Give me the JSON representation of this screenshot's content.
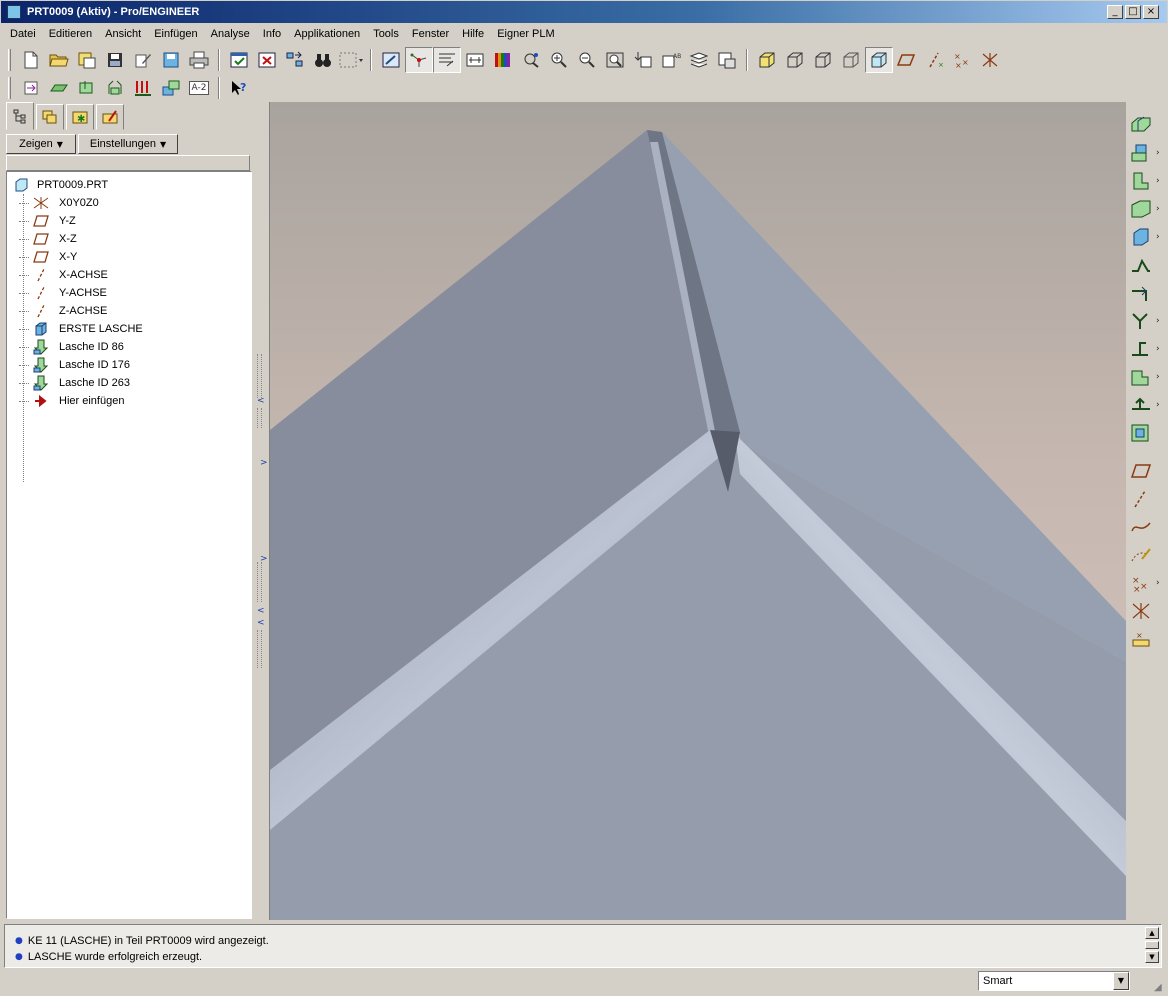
{
  "window": {
    "title": "PRT0009 (Aktiv) - Pro/ENGINEER",
    "buttons": [
      "_",
      "□",
      "×"
    ]
  },
  "menu": [
    {
      "label": "Datei"
    },
    {
      "label": "Editieren"
    },
    {
      "label": "Ansicht"
    },
    {
      "label": "Einfügen"
    },
    {
      "label": "Analyse"
    },
    {
      "label": "Info"
    },
    {
      "label": "Applikationen"
    },
    {
      "label": "Tools"
    },
    {
      "label": "Fenster"
    },
    {
      "label": "Hilfe"
    },
    {
      "label": "Eigner PLM"
    }
  ],
  "toolbar": {
    "row1": [
      "new-file",
      "open-folder",
      "save-as",
      "save",
      "edit",
      "disk",
      "print",
      "regenerate",
      "close-window",
      "swap",
      "binoculars",
      "select-box",
      "repaint",
      "spin-center",
      "saved-views",
      "orient",
      "color-appearance",
      "layers",
      "zoom-in",
      "zoom-out",
      "refit",
      "reorient",
      "view-manager",
      "layer-tree",
      "model-display",
      "wireframe",
      "hidden-line",
      "no-hidden",
      "shaded",
      "datum-planes",
      "datum-axes",
      "datum-points",
      "csys"
    ],
    "row2": [
      "import",
      "sheet",
      "merge",
      "scale",
      "analysis",
      "move",
      "text-a2",
      "context-help"
    ],
    "text_icon_label": "A-2"
  },
  "left_panel": {
    "tabs": [
      "model-tree-tab",
      "layers-tab",
      "favorites-tab",
      "folder-tab"
    ],
    "show_button": "Zeigen",
    "settings_button": "Einstellungen",
    "root": "PRT0009.PRT",
    "items": [
      {
        "label": "X0Y0Z0",
        "icon": "csys-icon"
      },
      {
        "label": "Y-Z",
        "icon": "datum-plane-icon"
      },
      {
        "label": "X-Z",
        "icon": "datum-plane-icon"
      },
      {
        "label": "X-Y",
        "icon": "datum-plane-icon"
      },
      {
        "label": "X-ACHSE",
        "icon": "datum-axis-icon"
      },
      {
        "label": "Y-ACHSE",
        "icon": "datum-axis-icon"
      },
      {
        "label": "Z-ACHSE",
        "icon": "datum-axis-icon"
      },
      {
        "label": "ERSTE LASCHE",
        "icon": "first-wall-icon"
      },
      {
        "label": "Lasche ID 86",
        "icon": "flange-icon"
      },
      {
        "label": "Lasche ID 176",
        "icon": "flange-icon"
      },
      {
        "label": "Lasche ID 263",
        "icon": "flange-icon"
      },
      {
        "label": "Hier einfügen",
        "icon": "insert-here-icon"
      }
    ]
  },
  "right_toolbar": {
    "items": [
      "unattached-wall",
      "flat-wall",
      "flange-wall",
      "extend-wall",
      "extrude-wall",
      "bend",
      "edge-bend",
      "unbend",
      "bend-back",
      "form",
      "flatten",
      "rip",
      "conversion",
      "datum-plane",
      "datum-axis",
      "datum-curve",
      "sketched-datum",
      "datum-point",
      "coord-system",
      "analysis-feature"
    ]
  },
  "messages": [
    "KE 11 (LASCHE) in Teil PRT0009 wird angezeigt.",
    "LASCHE wurde erfolgreich erzeugt."
  ],
  "status": {
    "filter": "Smart"
  },
  "colors": {
    "title_bar": "#0a246a",
    "background_top": "#a9a39e",
    "background_bottom": "#d6c8c0",
    "model_face": "#8a94a6",
    "model_highlight": "#b8c0d0",
    "message_bullet": "#2040c0"
  }
}
